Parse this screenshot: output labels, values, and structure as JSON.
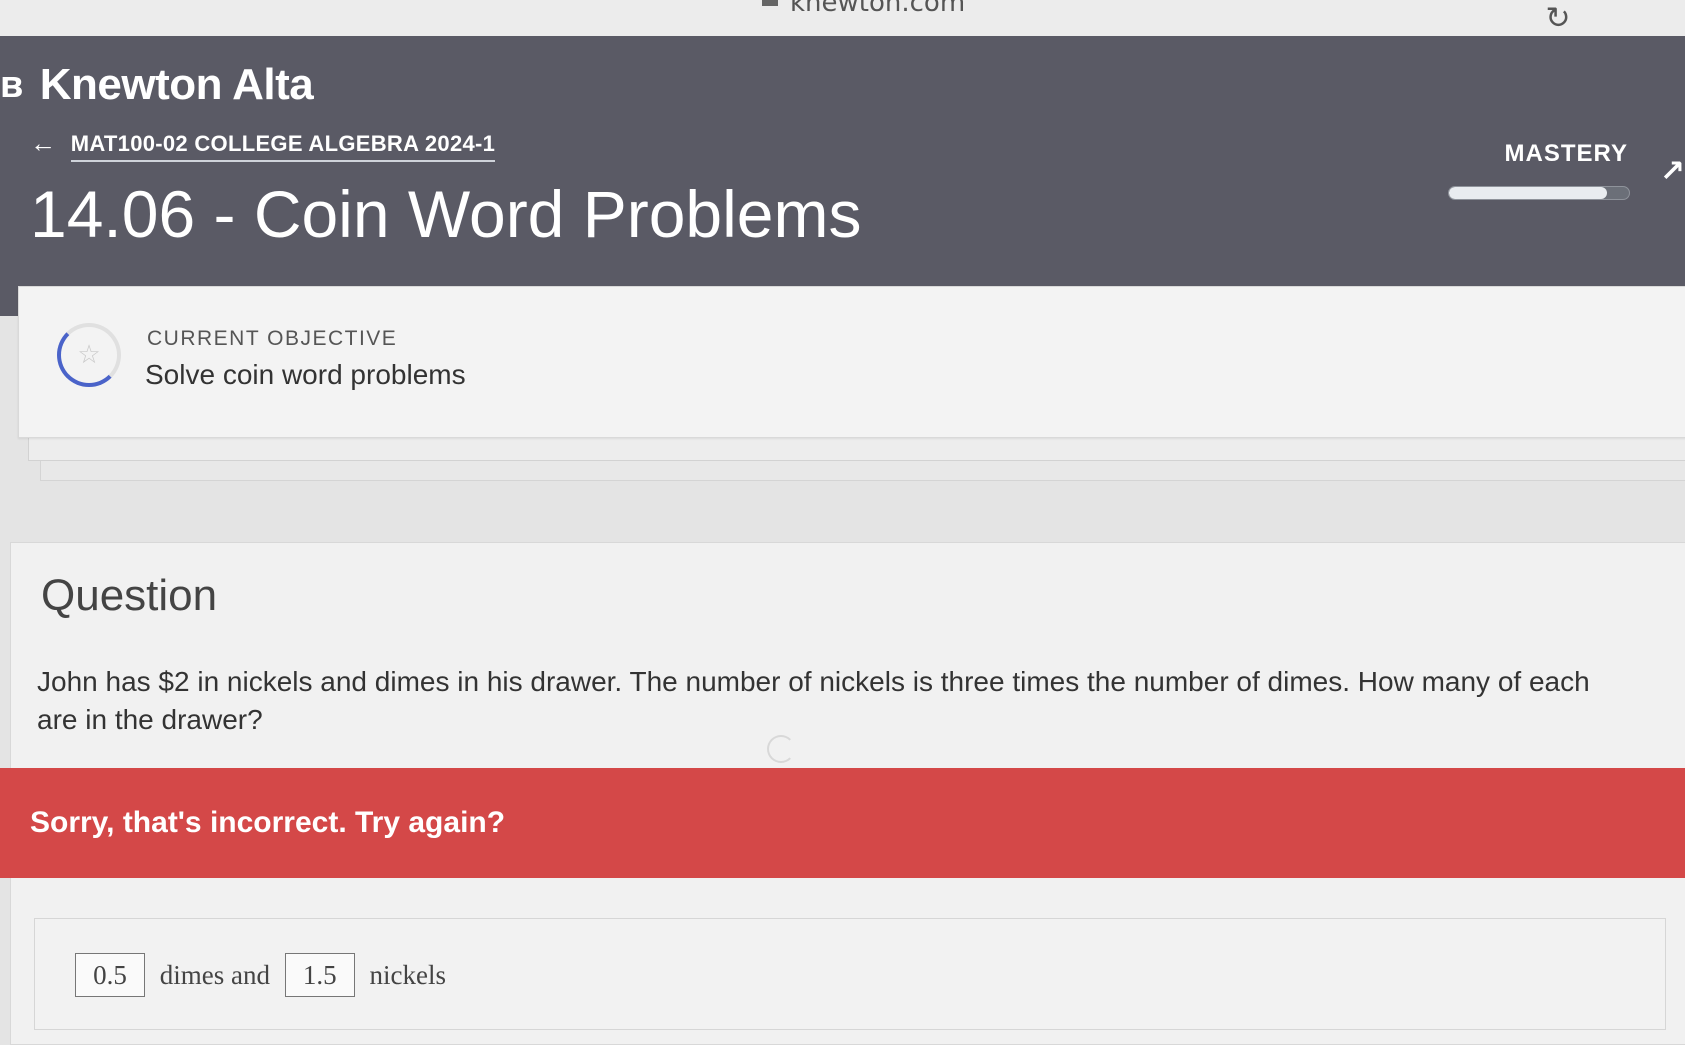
{
  "browser": {
    "url": "knewton.com"
  },
  "header": {
    "brand": "Knewton Alta",
    "course": "MAT100-02 COLLEGE ALGEBRA 2024-1",
    "title": "14.06 - Coin Word Problems",
    "mastery_label": "MASTERY",
    "mastery_progress": 0.88
  },
  "objective": {
    "heading": "CURRENT OBJECTIVE",
    "text": "Solve coin word problems"
  },
  "question": {
    "heading": "Question",
    "text": "John has $2 in nickels and dimes in his drawer. The number of nickels is three times the number of dimes. How many of each are in the drawer?"
  },
  "feedback": {
    "text": "Sorry, that's incorrect. Try again?"
  },
  "answer": {
    "dimes_value": "0.5",
    "dimes_label": "dimes and",
    "nickels_value": "1.5",
    "nickels_label": "nickels"
  },
  "colors": {
    "header_bg": "#5a5a65",
    "error_banner": "#d44848",
    "objective_ring": "#4a63c9"
  }
}
